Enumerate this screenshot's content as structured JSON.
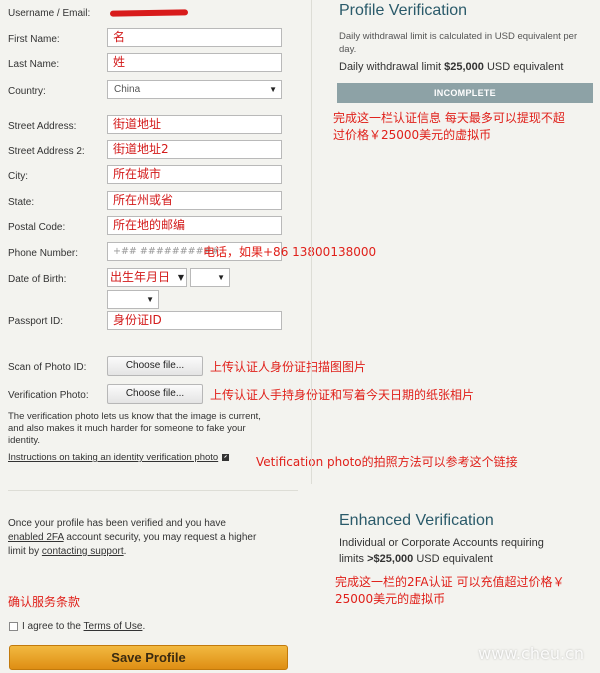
{
  "form": {
    "username_label": "Username / Email:",
    "username_value": "",
    "first_name": {
      "label": "First Name:",
      "value": "名"
    },
    "last_name": {
      "label": "Last Name:",
      "value": "姓"
    },
    "country": {
      "label": "Country:",
      "value": "China"
    },
    "street1": {
      "label": "Street Address:",
      "value": "街道地址"
    },
    "street2": {
      "label": "Street Address 2:",
      "value": "街道地址2"
    },
    "city": {
      "label": "City:",
      "value": "所在城市"
    },
    "state": {
      "label": "State:",
      "value": "所在州或省"
    },
    "postal": {
      "label": "Postal Code:",
      "value": "所在地的邮编"
    },
    "phone": {
      "label": "Phone Number:",
      "placeholder": "+## ##########",
      "annotation": "电话，如果+86 13800138000"
    },
    "dob": {
      "label": "Date of Birth:",
      "value": "出生年月日"
    },
    "passport": {
      "label": "Passport ID:",
      "value": "身份证ID"
    },
    "scan": {
      "label": "Scan of Photo ID:",
      "button": "Choose file...",
      "annotation": "上传认证人身份证扫描图图片"
    },
    "verif": {
      "label": "Verification Photo:",
      "button": "Choose file...",
      "annotation": "上传认证人手持身份证和写着今天日期的纸张相片"
    },
    "verif_note": "The verification photo lets us know that the image is current, and also makes it much harder for someone to fake your identity.",
    "instructions_link": "Instructions on taking an identity verification photo",
    "instructions_annotation": "Vetification photo的拍照方法可以参考这个链接",
    "enhanced_note_1": "Once your profile has been verified and you have",
    "enhanced_note_2a": "enabled 2FA",
    "enhanced_note_2b": " account security, you may request a higher",
    "enhanced_note_3a": "limit by ",
    "enhanced_note_3b": "contacting support",
    "enhanced_note_3c": ".",
    "terms_annotation": "确认服务条款",
    "terms_text_a": "I agree to the ",
    "terms_link": "Terms of Use",
    "terms_text_c": ".",
    "save_label": "Save Profile"
  },
  "profile_verification": {
    "title": "Profile Verification",
    "desc": "Daily withdrawal limit is calculated in USD equivalent per day.",
    "limit_prefix": "Daily withdrawal limit ",
    "limit_amount": "$25,000",
    "limit_suffix": " USD equivalent",
    "status": "INCOMPLETE",
    "annotation_1": "完成这一栏认证信息 每天最多可以提现不超",
    "annotation_2": "过价格￥25000美元的虚拟币"
  },
  "enhanced_verification": {
    "title": "Enhanced Verification",
    "line1": "Individual or Corporate Accounts requiring",
    "line2_prefix": "limits ",
    "line2_amount": ">$25,000",
    "line2_suffix": " USD equivalent",
    "annotation_1": "完成这一栏的2FA认证 可以充值超过价格￥",
    "annotation_2": "25000美元的虚拟币"
  },
  "watermark": "www.cheu.cn",
  "colors": {
    "accent": "#2a5a6a",
    "annotation": "#e0201a",
    "save": "#e3a02a",
    "status_bar": "#8da2a6"
  }
}
